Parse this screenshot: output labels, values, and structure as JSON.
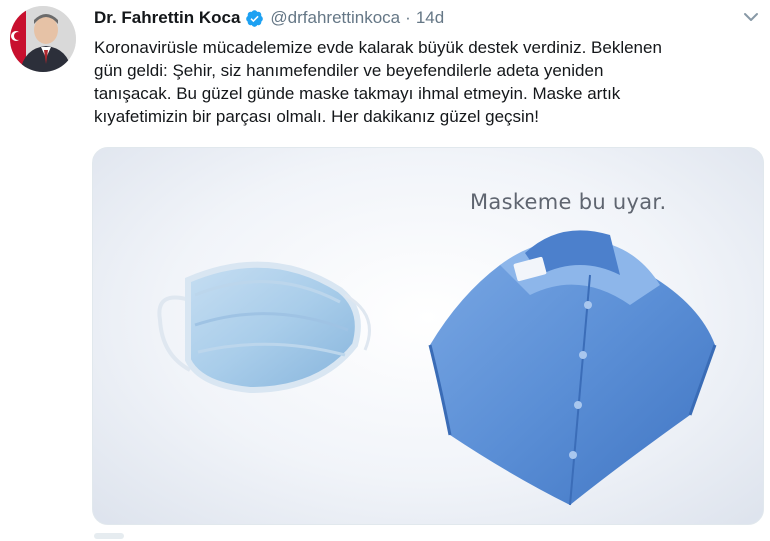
{
  "tweet": {
    "author_name": "Dr. Fahrettin Koca",
    "handle": "@drfahrettinkoca",
    "separator": "·",
    "time": "14d",
    "verified_icon": "verified-badge-icon",
    "caret_icon": "chevron-down-icon",
    "text": "Koronavirüsle mücadelemize evde kalarak büyük destek verdiniz. Beklenen\ngün geldi: Şehir, siz hanımefendiler ve beyefendilerle adeta yeniden\ntanışacak. Bu güzel günde maske takmayı ihmal etmeyin. Maske artık\nkıyafetimizin bir parçası olmalı. Her dakikanız güzel geçsin!"
  },
  "media": {
    "caption": "Maskeme bu uyar.",
    "images": [
      "surgical-mask-image",
      "folded-blue-shirt-image"
    ]
  },
  "colors": {
    "verified": "#1da1f2",
    "text": "#14171a",
    "secondary": "#657786",
    "shirt": "#5b8fd6",
    "mask": "#a9cdea"
  }
}
